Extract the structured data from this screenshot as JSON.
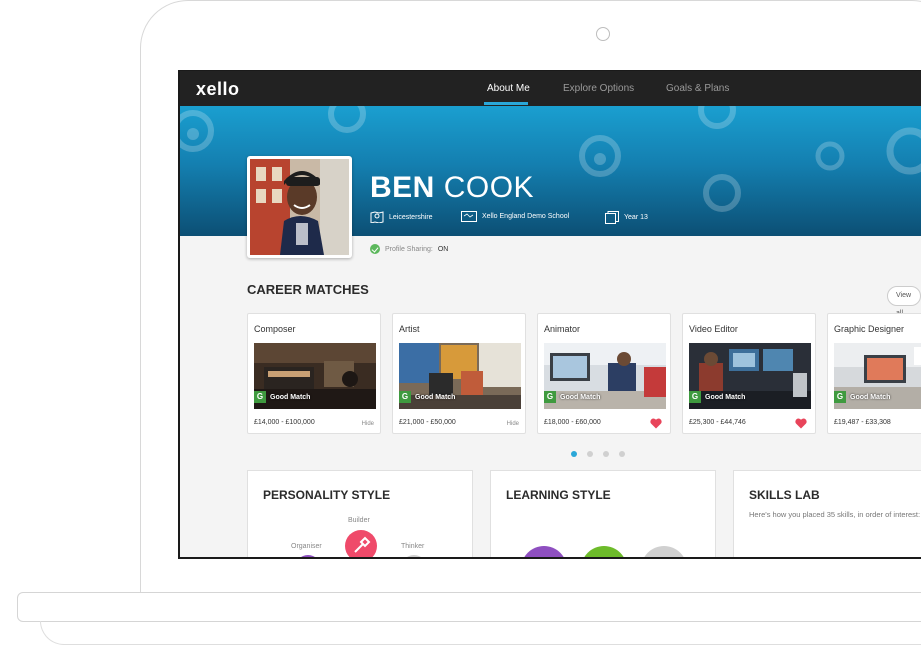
{
  "brand": {
    "logo": "xello",
    "accent": "#2aa7d8"
  },
  "nav": {
    "items": [
      {
        "label": "About Me",
        "active": true
      },
      {
        "label": "Explore Options",
        "active": false
      },
      {
        "label": "Goals & Plans",
        "active": false
      }
    ]
  },
  "profile": {
    "first_name": "BEN",
    "last_name": "COOK",
    "location": "Leicestershire",
    "school": "Xello England Demo School",
    "year": "Year 13",
    "sharing_label": "Profile Sharing:",
    "sharing_value": "ON"
  },
  "career_matches": {
    "title": "CAREER MATCHES",
    "view_all_label": "View all",
    "cards": [
      {
        "title": "Composer",
        "match": "Good Match",
        "badge": "G",
        "salary": "£14,000 - £100,000",
        "action": "Hide",
        "favourited": false
      },
      {
        "title": "Artist",
        "match": "Good Match",
        "badge": "G",
        "salary": "£21,000 - £50,000",
        "action": "Hide",
        "favourited": false
      },
      {
        "title": "Animator",
        "match": "Good Match",
        "badge": "G",
        "salary": "£18,000 - £60,000",
        "action": "",
        "favourited": true
      },
      {
        "title": "Video Editor",
        "match": "Good Match",
        "badge": "G",
        "salary": "£25,300 - £44,746",
        "action": "",
        "favourited": true
      },
      {
        "title": "Graphic Designer",
        "match": "Good Match",
        "badge": "G",
        "salary": "£19,487 - £33,308",
        "action": "",
        "favourited": false
      }
    ],
    "pagination": {
      "pages": 4,
      "current": 1
    }
  },
  "panels": {
    "personality": {
      "title": "PERSONALITY STYLE",
      "labels": {
        "builder": "Builder",
        "organiser": "Organiser",
        "thinker": "Thinker"
      }
    },
    "learning": {
      "title": "LEARNING STYLE"
    },
    "skills": {
      "title": "SKILLS LAB",
      "text": "Here's how you placed 35 skills, in order of interest:"
    }
  },
  "colors": {
    "nav_bg": "#222222",
    "banner_top": "#1a9fd0",
    "banner_bottom": "#0c4f74",
    "good_match": "#3f9a3f",
    "heart": "#e8445a",
    "builder": "#ef4a6a",
    "purple": "#8e4fc0",
    "green": "#6dbb2a"
  }
}
